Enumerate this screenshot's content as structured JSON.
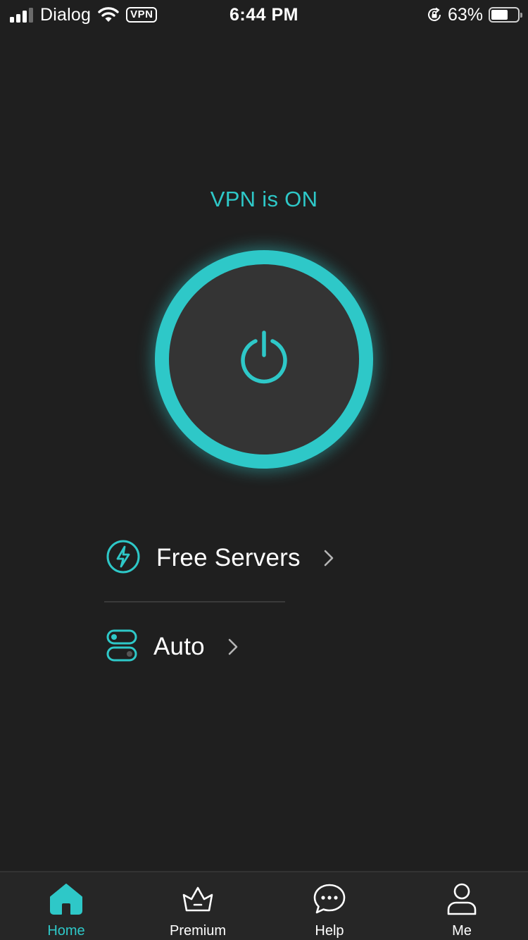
{
  "status_bar": {
    "carrier": "Dialog",
    "vpn_badge": "VPN",
    "time": "6:44 PM",
    "battery_percent": "63%",
    "battery_level": 0.63,
    "signal_bars_filled": 3,
    "signal_bars_total": 4
  },
  "main": {
    "vpn_status": "VPN is ON",
    "power_icon": "power-icon",
    "servers": {
      "label": "Free Servers",
      "icon": "lightning-icon"
    },
    "location": {
      "label": "Auto",
      "icon": "server-toggle-icon"
    }
  },
  "tab_bar": {
    "tabs": [
      {
        "label": "Home",
        "icon": "home-icon",
        "active": true
      },
      {
        "label": "Premium",
        "icon": "crown-icon",
        "active": false
      },
      {
        "label": "Help",
        "icon": "chat-bubble-icon",
        "active": false
      },
      {
        "label": "Me",
        "icon": "person-icon",
        "active": false
      }
    ]
  },
  "colors": {
    "accent": "#2ec8c8",
    "background": "#1f1f1f",
    "button_face": "#343434",
    "tab_bar": "#262626"
  }
}
